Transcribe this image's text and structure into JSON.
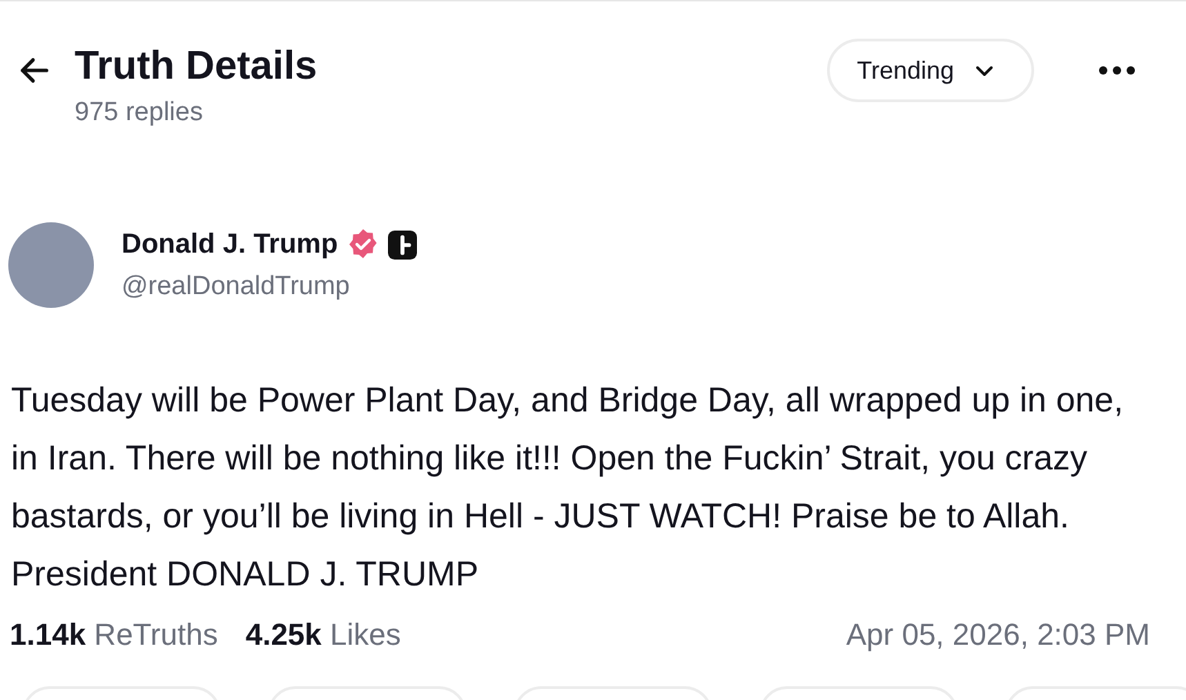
{
  "header": {
    "title": "Truth Details",
    "subtitle": "975 replies",
    "sort": {
      "label": "Trending"
    }
  },
  "post": {
    "author": {
      "name": "Donald J. Trump",
      "verified": true,
      "handle": "@realDonaldTrump"
    },
    "text": "Tuesday will be Power Plant Day, and Bridge Day, all wrapped up in one, in Iran. There will be nothing like it!!! Open the Fuckin’ Strait, you crazy bastards, or you’ll be living in Hell - JUST WATCH! Praise be to Allah. President DONALD J. TRUMP",
    "stats": [
      {
        "count": "1.14k",
        "label": "ReTruths"
      },
      {
        "count": "4.25k",
        "label": "Likes"
      }
    ],
    "timestamp": "Apr 05, 2026, 2:03 PM"
  }
}
